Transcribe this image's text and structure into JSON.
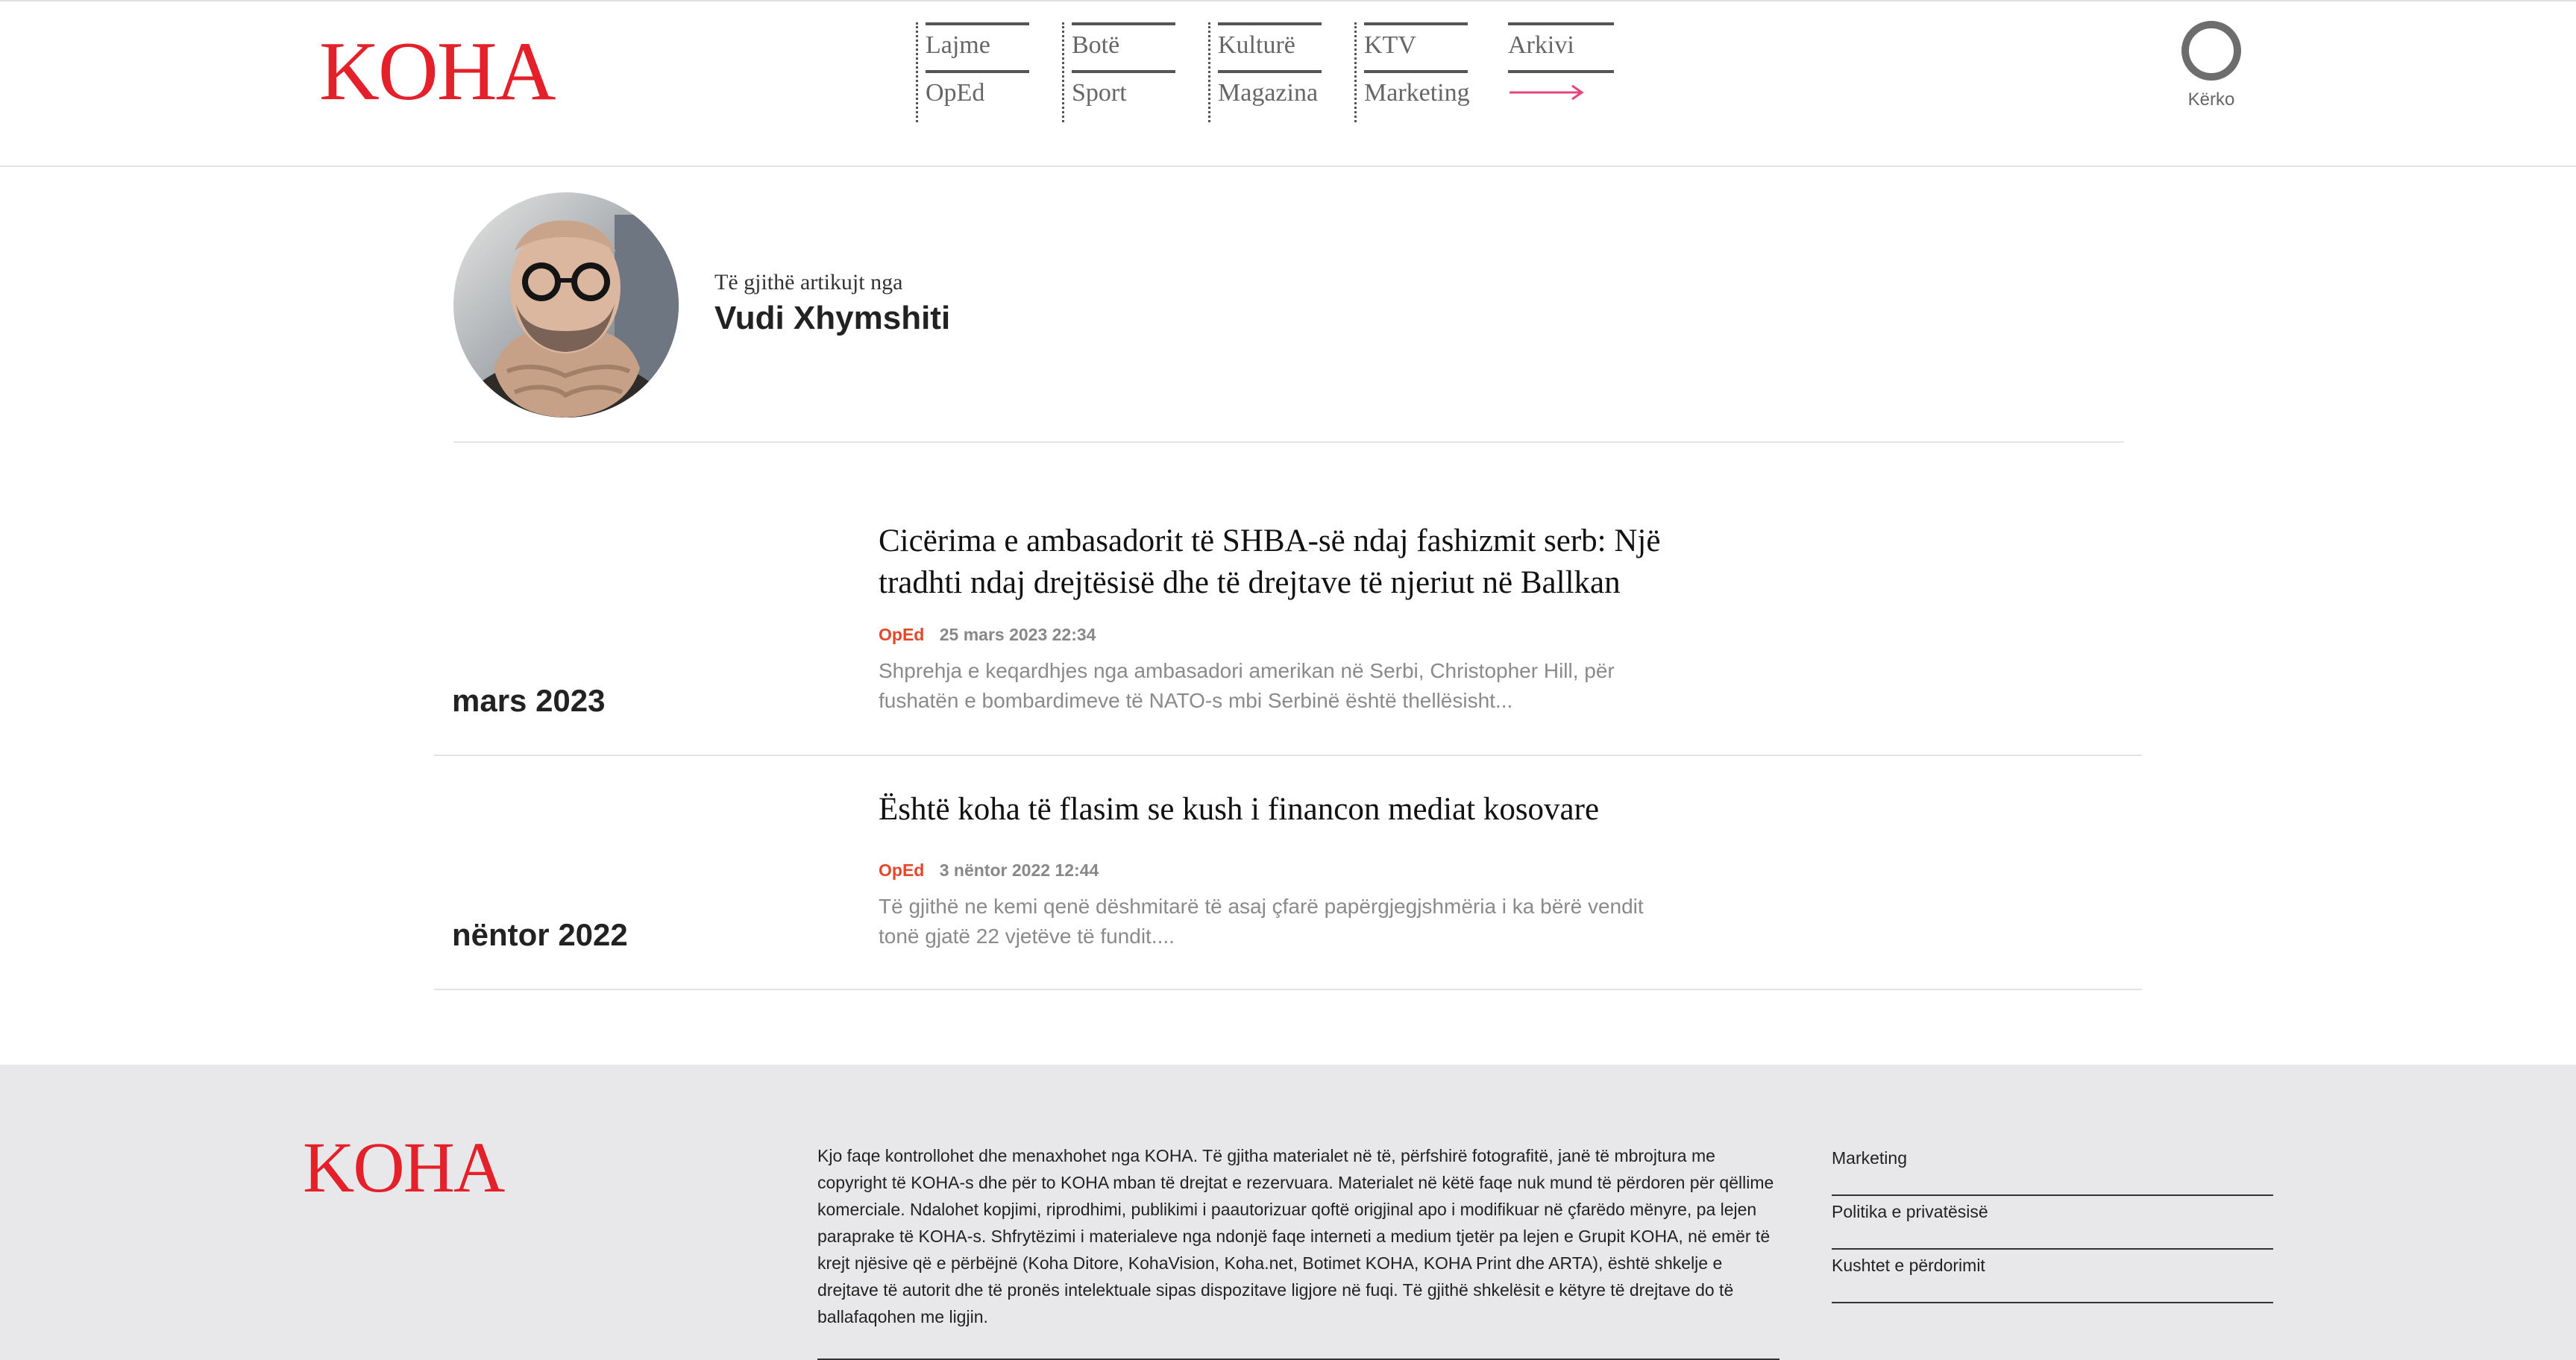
{
  "header": {
    "logo": "KOHA",
    "nav": [
      [
        "Lajme",
        "OpEd"
      ],
      [
        "Botë",
        "Sport"
      ],
      [
        "Kulturë",
        "Magazina"
      ],
      [
        "KTV",
        "Marketing"
      ],
      [
        "Arkivi",
        ""
      ]
    ],
    "search_label": "Kërko",
    "icons": {
      "search": "search-ring-icon",
      "more": "arrow-right-icon"
    },
    "accent": "#e4202a"
  },
  "author": {
    "intro": "Të gjithë artikujt nga",
    "name": "Vudi Xhymshiti"
  },
  "articles": [
    {
      "month": "mars 2023",
      "title": "Cicërima e ambasadorit të SHBA-së ndaj fashizmit serb: Një tradhti ndaj drejtësisë dhe të drejtave të njeriut në Ballkan",
      "category": "OpEd",
      "date": "25 mars 2023 22:34",
      "excerpt": "Shprehja e keqardhjes nga ambasadori amerikan në Serbi, Christopher Hill, për fushatën e bombardimeve të NATO-s mbi Serbinë është thellësisht..."
    },
    {
      "month": "nëntor 2022",
      "title": "Është koha të flasim se kush i financon mediat kosovare",
      "category": "OpEd",
      "date": "3 nëntor 2022 12:44",
      "excerpt": "Të gjithë ne kemi qenë dëshmitarë të asaj çfarë papërgjegjshmëria i ka bërë vendit tonë gjatë 22 vjetëve të fundit...."
    }
  ],
  "footer": {
    "logo": "KOHA",
    "text": "Kjo faqe kontrollohet dhe menaxhohet nga KOHA. Të gjitha materialet në të, përfshirë fotografitë, janë të mbrojtura me copyright të KOHA-s dhe për to KOHA mban të drejtat e rezervuara. Materialet në këtë faqe nuk mund të përdoren për qëllime komerciale. Ndalohet kopjimi, riprodhimi, publikimi i paautorizuar qoftë origjinal apo i modifikuar në çfarëdo mënyre, pa lejen paraprake të KOHA-s. Shfrytëzimi i materialeve nga ndonjë faqe interneti a medium tjetër pa lejen e Grupit KOHA, në emër të krejt njësive që e përbëjnë (Koha Ditore, KohaVision, Koha.net, Botimet KOHA, KOHA Print dhe ARTA), është shkelje e drejtave të autorit dhe të pronës intelektuale sipas dispozitave ligjore në fuqi. Të gjithë shkelësit e këtyre të drejtave do të ballafaqohen me ligjin.",
    "links": [
      "Marketing",
      "Politika e privatësisë",
      "Kushtet e përdorimit"
    ]
  }
}
